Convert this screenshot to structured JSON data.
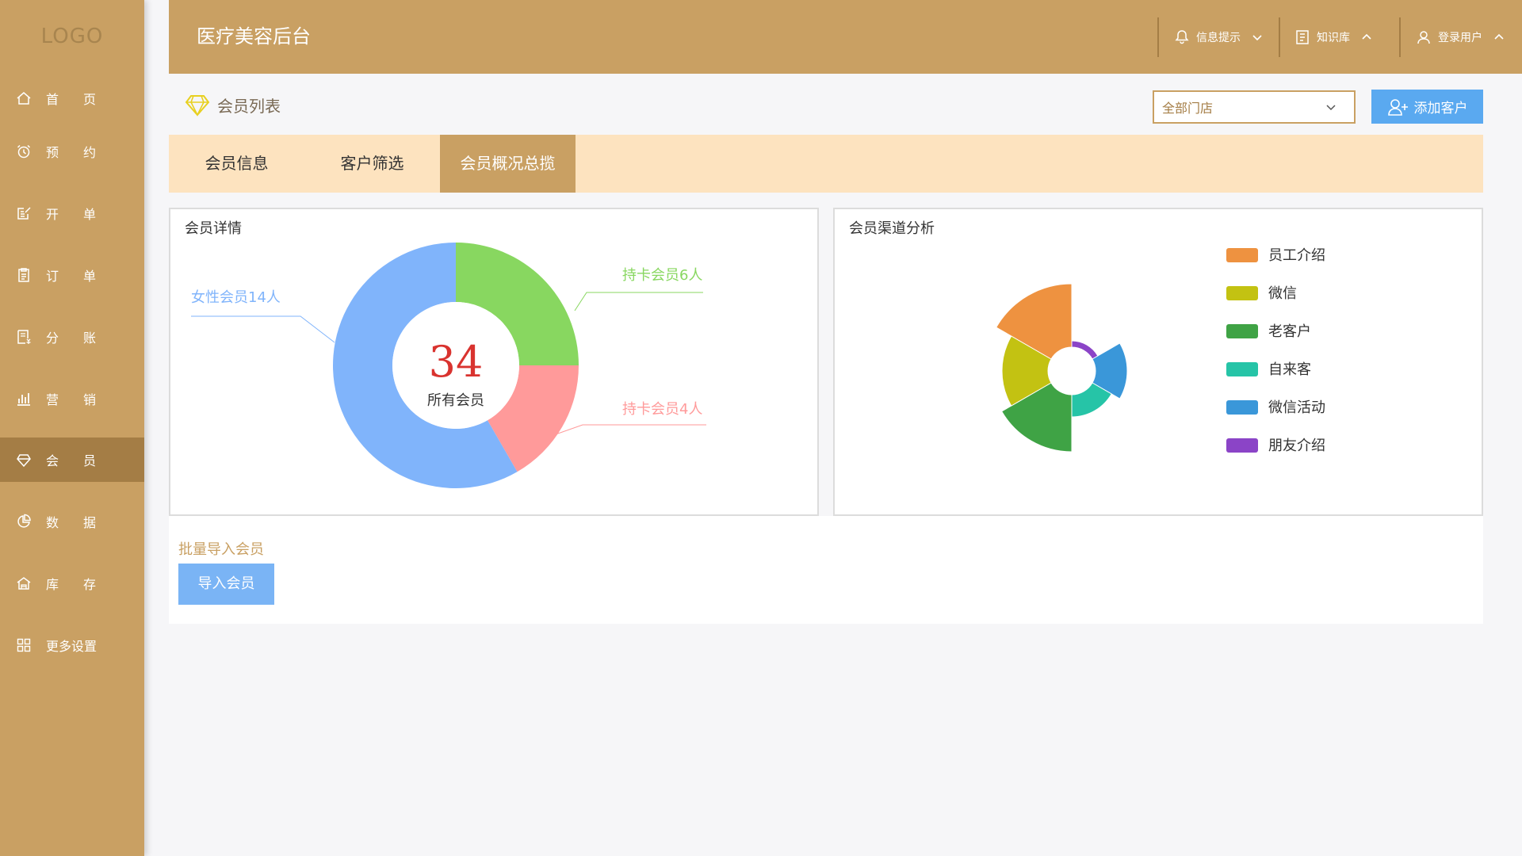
{
  "sidebar": {
    "logo": "LOGO",
    "items": [
      {
        "label": "首页",
        "icon": "home-icon"
      },
      {
        "label": "预约",
        "icon": "alarm-clock-icon"
      },
      {
        "label": "开单",
        "icon": "edit-doc-icon"
      },
      {
        "label": "订单",
        "icon": "clipboard-icon"
      },
      {
        "label": "分账",
        "icon": "bill-icon"
      },
      {
        "label": "营销",
        "icon": "bar-chart-icon"
      },
      {
        "label": "会员",
        "icon": "diamond-icon",
        "active": true
      },
      {
        "label": "数据",
        "icon": "pie-chart-icon"
      },
      {
        "label": "库存",
        "icon": "warehouse-icon"
      },
      {
        "label": "更多设置",
        "icon": "grid-icon"
      }
    ]
  },
  "header": {
    "title": "医疗美容后台",
    "notifications": "信息提示",
    "knowledge": "知识库",
    "user": "登录用户"
  },
  "page": {
    "title": "会员列表",
    "store_select": "全部门店",
    "add_button": "添加客户"
  },
  "tabs": [
    {
      "label": "会员信息",
      "active": false
    },
    {
      "label": "客户筛选",
      "active": false
    },
    {
      "label": "会员概况总揽",
      "active": true
    }
  ],
  "panels": {
    "detail_title": "会员详情",
    "channel_title": "会员渠道分析",
    "center_value": "34",
    "center_label": "所有会员"
  },
  "chart_data": [
    {
      "type": "pie",
      "variant": "donut",
      "title": "会员详情",
      "slices": [
        {
          "label": "持卡会员6人",
          "value": 6,
          "color": "#88d760"
        },
        {
          "label": "持卡会员4人",
          "value": 4,
          "color": "#ff9a9a"
        },
        {
          "label": "女性会员14人",
          "value": 14,
          "color": "#80b4fb"
        }
      ]
    },
    {
      "type": "pie",
      "variant": "rose",
      "title": "会员渠道分析",
      "slices": [
        {
          "label": "朋友介绍",
          "value": 38,
          "color": "#8b44c7"
        },
        {
          "label": "微信活动",
          "value": 70,
          "color": "#3a97d9"
        },
        {
          "label": "自来客",
          "value": 58,
          "color": "#26c4a7"
        },
        {
          "label": "老客户",
          "value": 102,
          "color": "#3fa345"
        },
        {
          "label": "微信",
          "value": 88,
          "color": "#c3c212"
        },
        {
          "label": "员工介绍",
          "value": 110,
          "color": "#ee9240"
        }
      ],
      "legend": [
        "员工介绍",
        "微信",
        "老客户",
        "自来客",
        "微信活动",
        "朋友介绍"
      ],
      "legend_position": "right"
    }
  ],
  "lower": {
    "label": "批量导入会员",
    "button": "导入会员"
  }
}
